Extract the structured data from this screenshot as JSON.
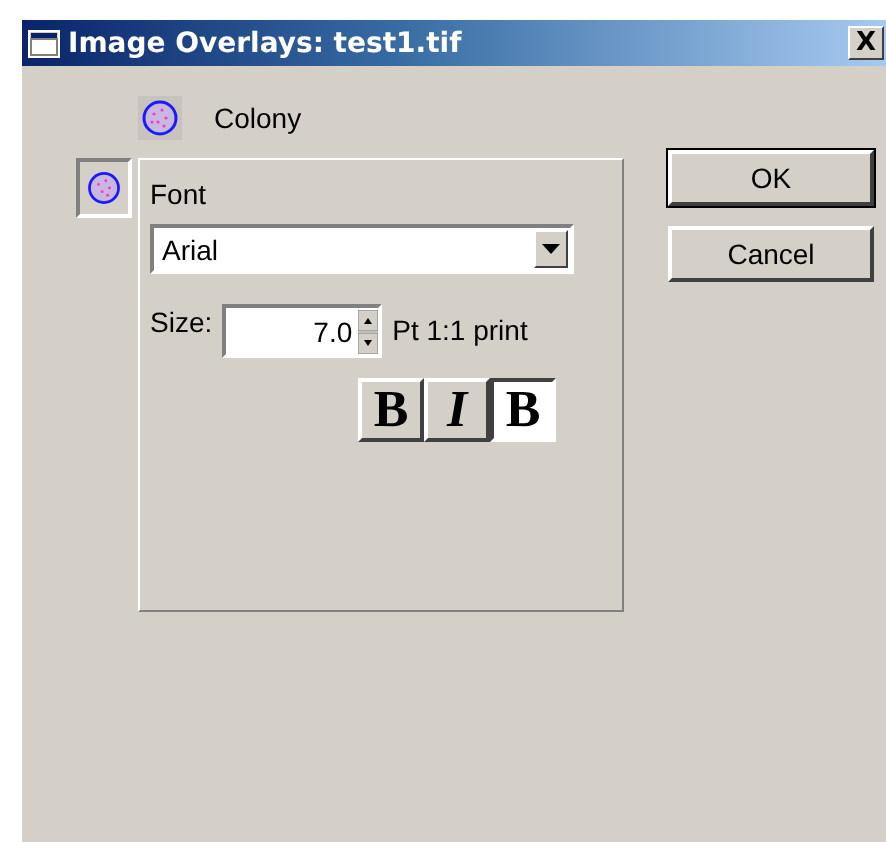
{
  "window": {
    "title": "Image Overlays: test1.tif",
    "close": "X"
  },
  "overlay": {
    "label": "Colony"
  },
  "font": {
    "label": "Font",
    "value": "Arial",
    "size_label": "Size:",
    "size": "7.0",
    "size_unit": "Pt 1:1 print"
  },
  "styles": [
    {
      "label": "B",
      "kind": "bold",
      "pressed": false
    },
    {
      "label": "I",
      "kind": "italic",
      "pressed": false
    },
    {
      "label": "B",
      "kind": "background",
      "pressed": true
    }
  ],
  "buttons": [
    {
      "label": "OK",
      "default": true
    },
    {
      "label": "Cancel",
      "default": false
    }
  ]
}
